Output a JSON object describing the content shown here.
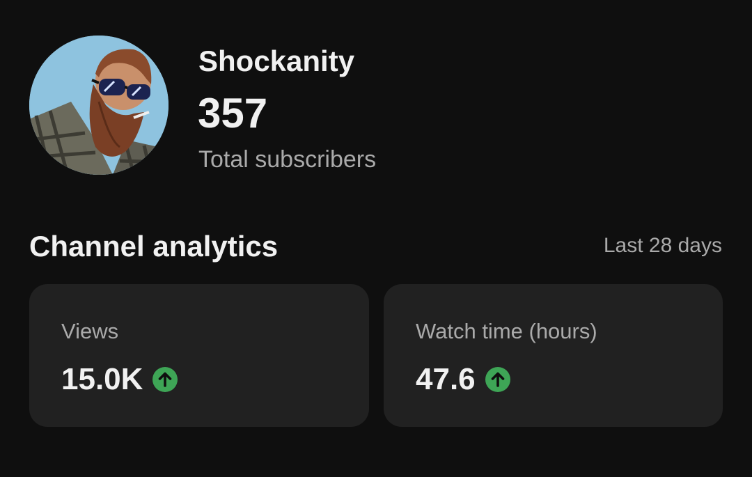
{
  "channel": {
    "name": "Shockanity",
    "subscriber_count": "357",
    "subscriber_label": "Total subscribers",
    "avatar_icon": "avatar-bearded-man-sunglasses"
  },
  "analytics": {
    "title": "Channel analytics",
    "range": "Last 28 days",
    "cards": [
      {
        "label": "Views",
        "value": "15.0K",
        "trend": "up",
        "trend_icon": "arrow-up-circle-icon"
      },
      {
        "label": "Watch time (hours)",
        "value": "47.6",
        "trend": "up",
        "trend_icon": "arrow-up-circle-icon"
      }
    ]
  },
  "colors": {
    "background": "#0f0f0f",
    "card": "#212121",
    "text_primary": "#f1f1f1",
    "text_secondary": "#aaaaaa",
    "trend_up": "#3ea556"
  }
}
